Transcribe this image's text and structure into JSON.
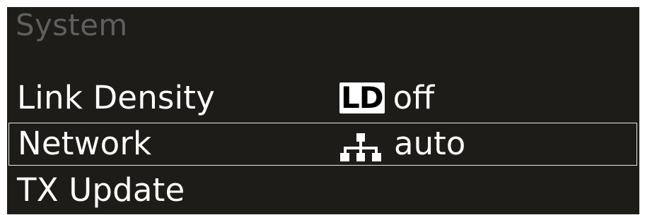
{
  "menu": {
    "title": "System",
    "items": [
      {
        "label": "Link Density",
        "icon": "ld-icon",
        "icon_text": "LD",
        "value": "off",
        "selected": false
      },
      {
        "label": "Network",
        "icon": "network-icon",
        "value": "auto",
        "selected": true
      },
      {
        "label": "TX Update",
        "value": "",
        "selected": false
      }
    ]
  },
  "colors": {
    "screen_bg": "#1e1c19",
    "title_text": "#5f5f5f",
    "text": "#ffffff",
    "selection_border": "#e8e8e8"
  }
}
